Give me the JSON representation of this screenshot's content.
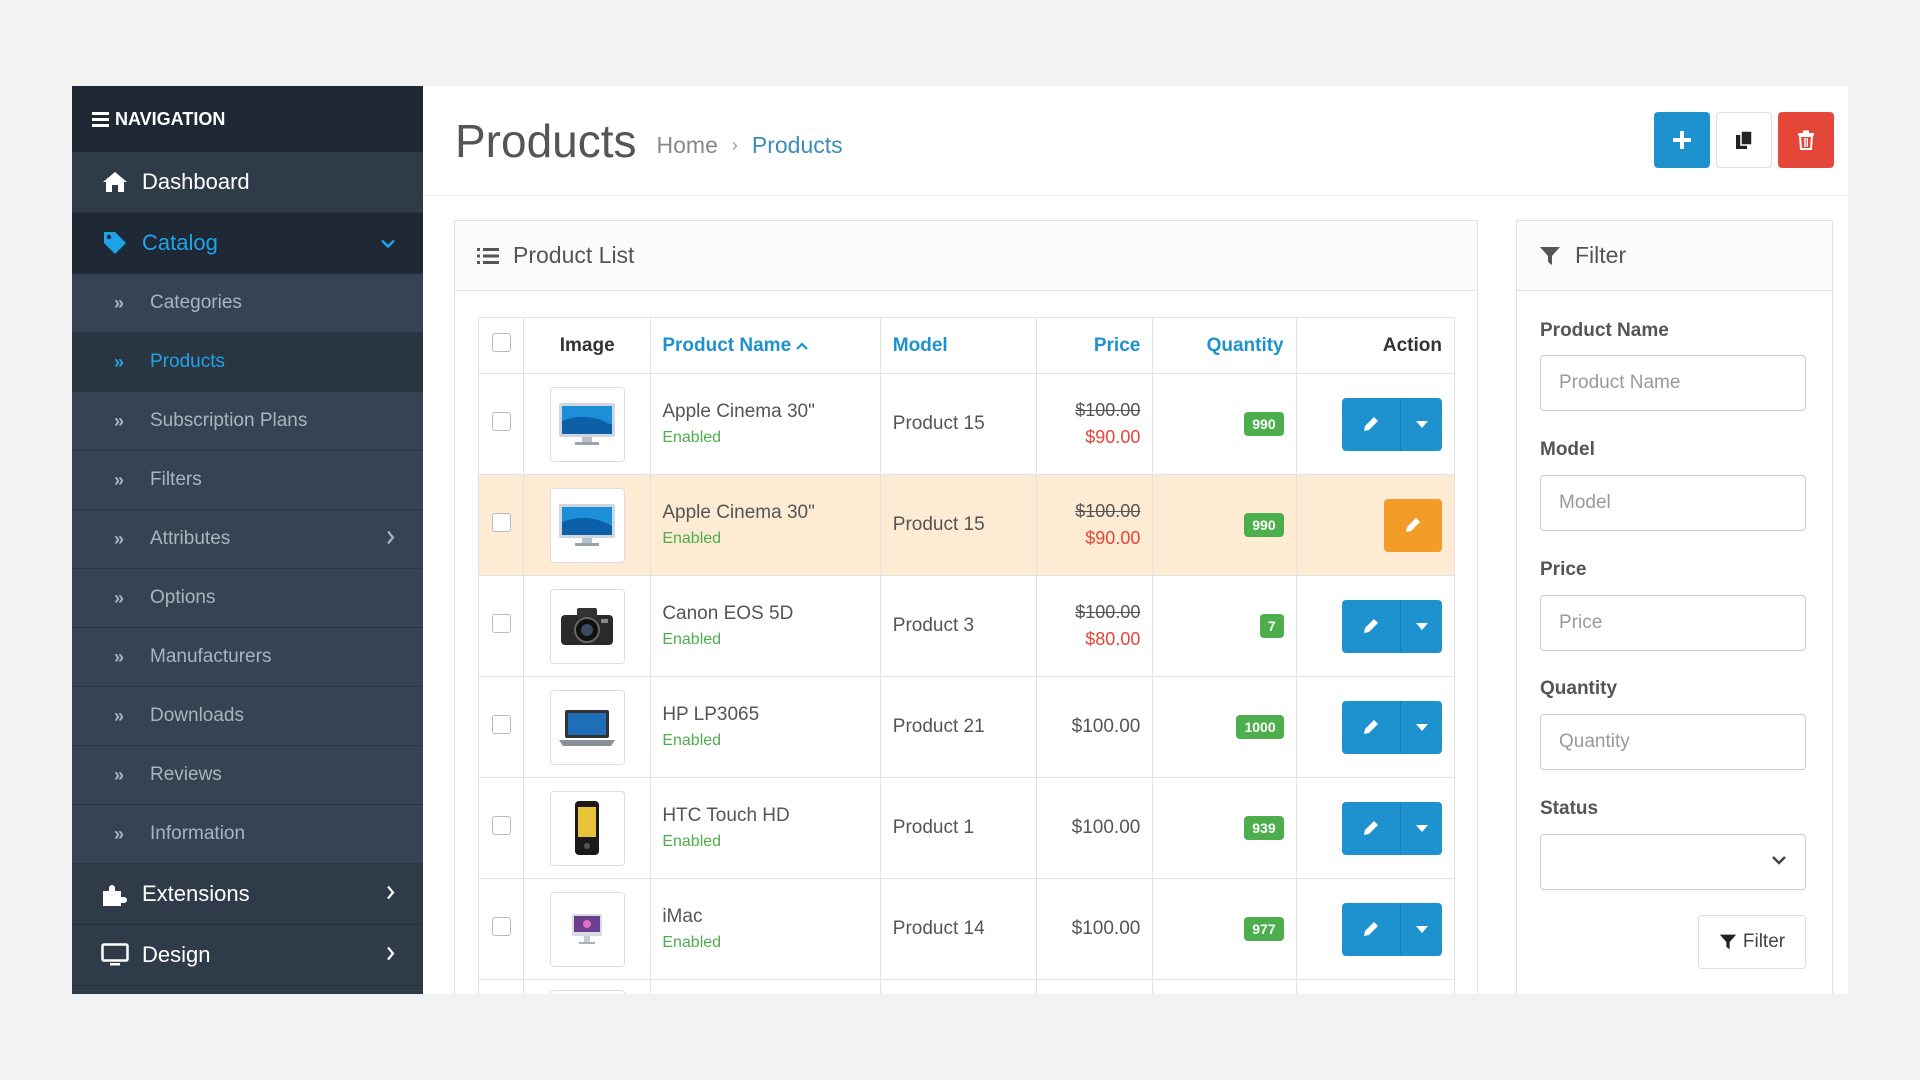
{
  "sidebar": {
    "header": "NAVIGATION",
    "items": [
      {
        "label": "Dashboard",
        "icon": "home-icon"
      },
      {
        "label": "Catalog",
        "icon": "tag-icon",
        "active": true
      },
      {
        "label": "Extensions",
        "icon": "puzzle-icon"
      },
      {
        "label": "Design",
        "icon": "monitor-icon"
      }
    ],
    "catalog_sub": [
      "Categories",
      "Products",
      "Subscription Plans",
      "Filters",
      "Attributes",
      "Options",
      "Manufacturers",
      "Downloads",
      "Reviews",
      "Information"
    ],
    "active_sub": "Products"
  },
  "header": {
    "title": "Products",
    "breadcrumb": [
      "Home",
      "Products"
    ],
    "buttons": [
      "add-icon",
      "copy-icon",
      "trash-icon"
    ]
  },
  "product_list": {
    "title": "Product List",
    "columns": [
      "Image",
      "Product Name",
      "Model",
      "Price",
      "Quantity",
      "Action"
    ],
    "sort_column": "Product Name",
    "rows": [
      {
        "name": "Apple Cinema 30\"",
        "status": "Enabled",
        "model": "Product 15",
        "price": "$100.00",
        "special": "$90.00",
        "qty": "990",
        "image": "monitor-icon",
        "highlight": false
      },
      {
        "name": "Apple Cinema 30\"",
        "status": "Enabled",
        "model": "Product 15",
        "price": "$100.00",
        "special": "$90.00",
        "qty": "990",
        "image": "monitor-icon",
        "highlight": true
      },
      {
        "name": "Canon EOS 5D",
        "status": "Enabled",
        "model": "Product 3",
        "price": "$100.00",
        "special": "$80.00",
        "qty": "7",
        "image": "camera-icon",
        "highlight": false
      },
      {
        "name": "HP LP3065",
        "status": "Enabled",
        "model": "Product 21",
        "price": "$100.00",
        "special": "",
        "qty": "1000",
        "image": "laptop-icon",
        "highlight": false
      },
      {
        "name": "HTC Touch HD",
        "status": "Enabled",
        "model": "Product 1",
        "price": "$100.00",
        "special": "",
        "qty": "939",
        "image": "phone-icon",
        "highlight": false
      },
      {
        "name": "iMac",
        "status": "Enabled",
        "model": "Product 14",
        "price": "$100.00",
        "special": "",
        "qty": "977",
        "image": "imac-icon",
        "highlight": false
      }
    ]
  },
  "filter": {
    "title": "Filter",
    "fields": [
      {
        "label": "Product Name",
        "placeholder": "Product Name"
      },
      {
        "label": "Model",
        "placeholder": "Model"
      },
      {
        "label": "Price",
        "placeholder": "Price"
      },
      {
        "label": "Quantity",
        "placeholder": "Quantity"
      }
    ],
    "status_label": "Status",
    "status_value": "",
    "button_label": "Filter"
  },
  "colors": {
    "sidebar_bg": "#2f3b49",
    "accent": "#1e91cf",
    "danger": "#e4473a",
    "warning": "#f39c28",
    "success": "#4cae4c",
    "highlight_row": "#fdebd4"
  }
}
